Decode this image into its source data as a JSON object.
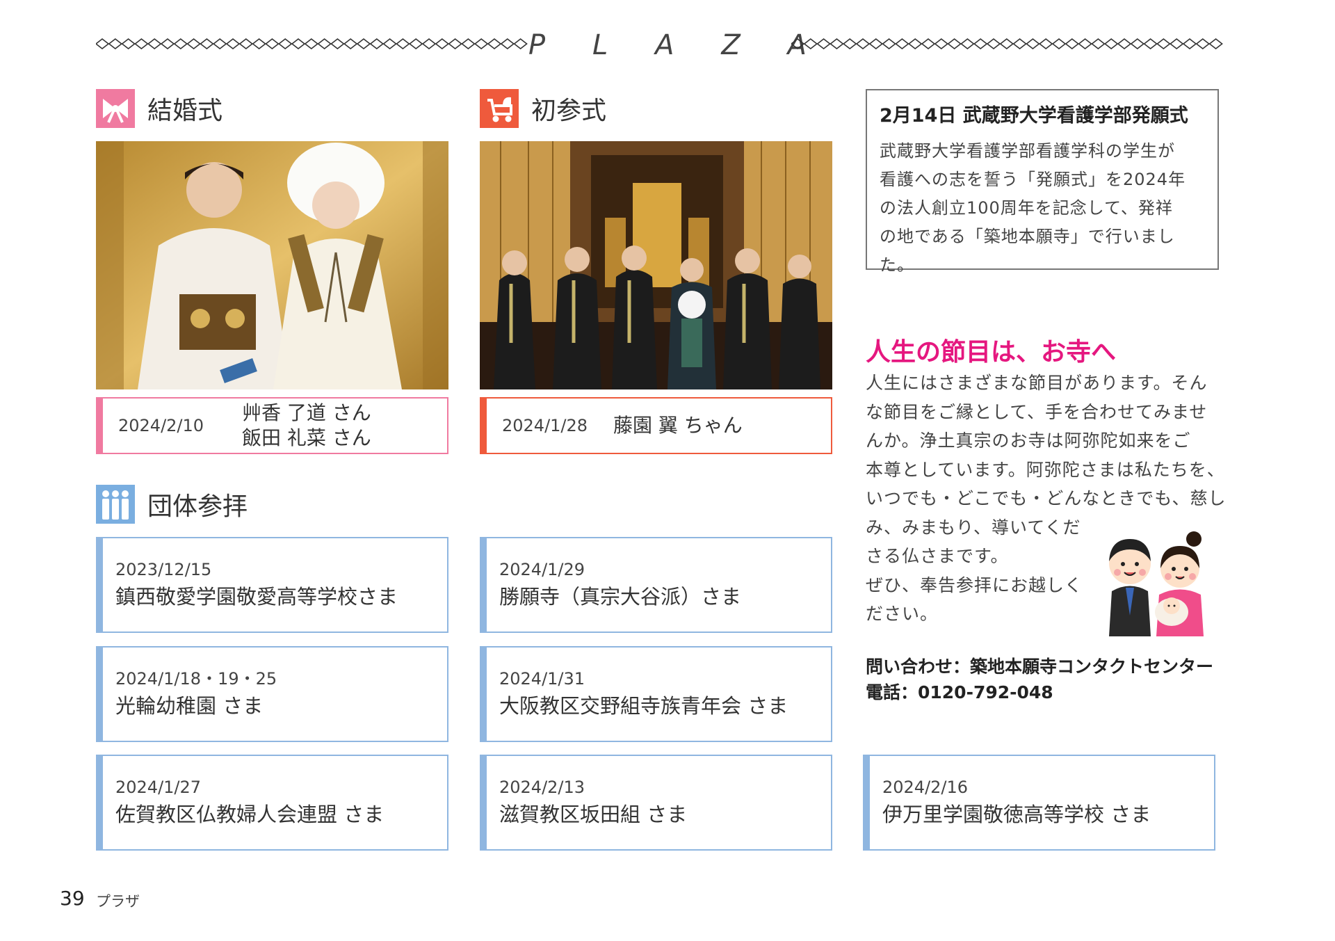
{
  "header": {
    "title_letters": [
      "P",
      "L",
      "A",
      "Z",
      "A"
    ]
  },
  "wedding": {
    "heading": "結婚式",
    "icon": "ribbon-icon",
    "icon_color": "#f07aa0",
    "border_color": "#f07aa0",
    "date": "2024/2/10",
    "names": [
      "艸香 了道 さん",
      "飯田 礼菜 さん"
    ]
  },
  "first_visit": {
    "heading": "初参式",
    "icon": "stroller-icon",
    "icon_color": "#ef5a3c",
    "border_color": "#ef5a3c",
    "date": "2024/1/28",
    "names": [
      "藤園 翼 ちゃん"
    ]
  },
  "group": {
    "heading": "団体参拝",
    "icon": "people-icon",
    "icon_color": "#7aaee0",
    "items": [
      {
        "date": "2023/12/15",
        "name": "鎮西敬愛学園敬愛高等学校さま"
      },
      {
        "date": "2024/1/29",
        "name": "勝願寺（真宗大谷派）さま"
      },
      {
        "date": "2024/1/18・19・25",
        "name": "光輪幼稚園 さま"
      },
      {
        "date": "2024/1/31",
        "name": "大阪教区交野組寺族青年会 さま"
      },
      {
        "date": "2024/1/27",
        "name": "佐賀教区仏教婦人会連盟 さま"
      },
      {
        "date": "2024/2/13",
        "name": "滋賀教区坂田組 さま"
      },
      {
        "date": "2024/2/16",
        "name": "伊万里学園敬徳高等学校 さま"
      }
    ]
  },
  "news": {
    "title": "2月14日 武蔵野大学看護学部発願式",
    "body": [
      "武蔵野大学看護学部看護学科の学生が",
      "看護への志を誓う「発願式」を2024年",
      "の法人創立100周年を記念して、発祥",
      "の地である「築地本願寺」で行いました。"
    ]
  },
  "promo": {
    "title": "人生の節目は、お寺へ",
    "title_color": "#e5177f",
    "body": [
      "人生にはさまざまな節目があります。そん",
      "な節目をご縁として、手を合わせてみませ",
      "んか。浄土真宗のお寺は阿弥陀如来をご",
      "本尊としています。阿弥陀さまは私たちを、",
      "いつでも・どこでも・どんなときでも、慈し",
      "み、みまもり、導いてくだ",
      "さる仏さまです。",
      "ぜひ、奉告参拝にお越しく",
      "ださい。"
    ],
    "contact_lines": [
      "問い合わせ：築地本願寺コンタクトセンター",
      "電話：0120-792-048"
    ]
  },
  "footer": {
    "page_number": "39",
    "label": "プラザ"
  }
}
